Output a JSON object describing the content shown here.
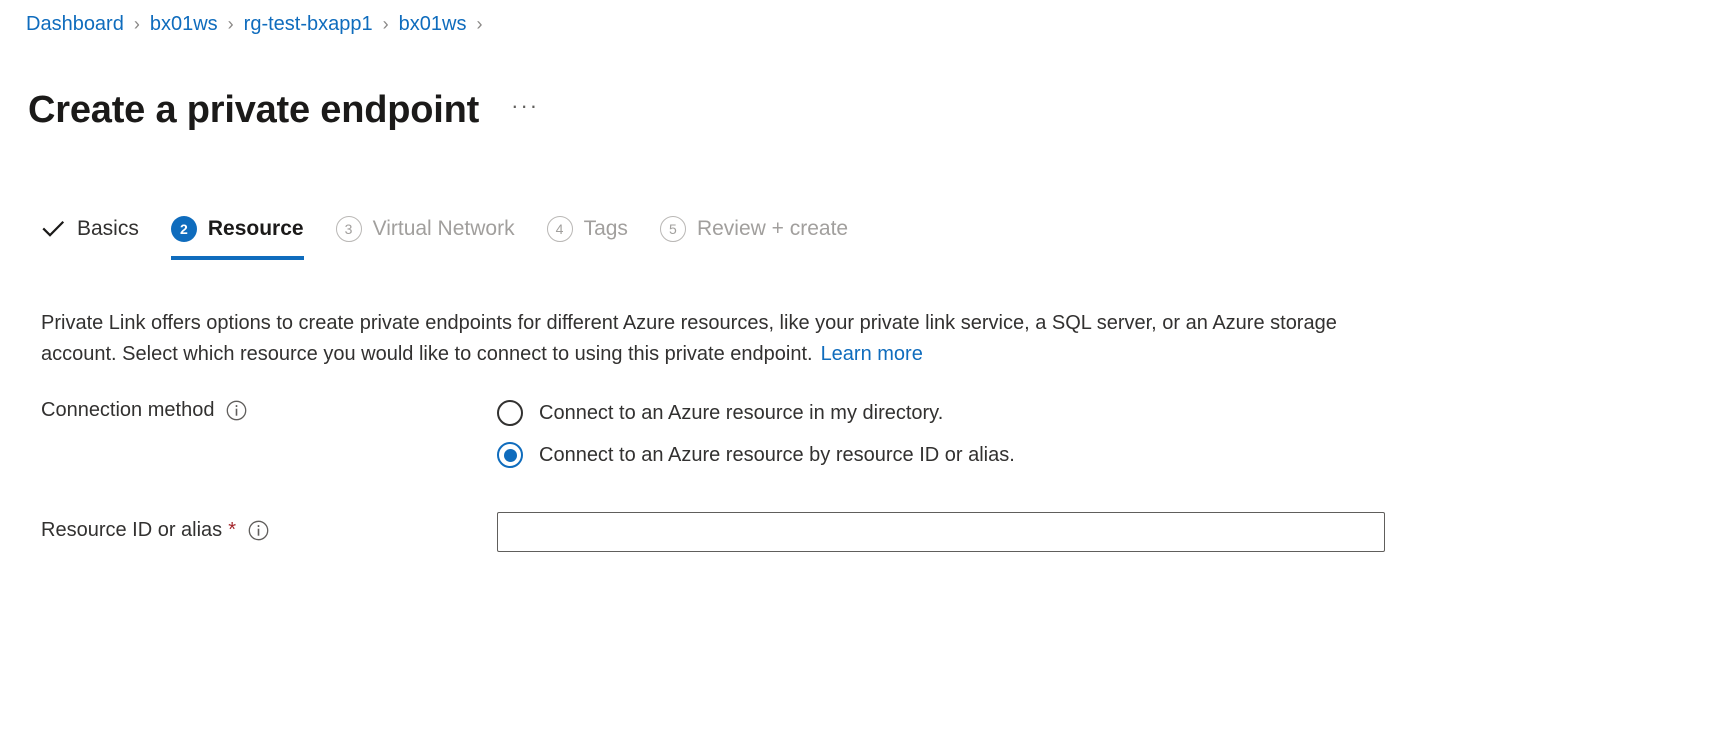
{
  "breadcrumb": {
    "separator": "›",
    "items": [
      {
        "label": "Dashboard"
      },
      {
        "label": "bx01ws"
      },
      {
        "label": "rg-test-bxapp1"
      },
      {
        "label": "bx01ws"
      }
    ],
    "trailing_separator": "›"
  },
  "header": {
    "title": "Create a private endpoint",
    "more_actions": "···"
  },
  "wizard": {
    "tabs": [
      {
        "label": "Basics",
        "badge": "✓",
        "state": "done"
      },
      {
        "label": "Resource",
        "badge": "2",
        "state": "active"
      },
      {
        "label": "Virtual Network",
        "badge": "3",
        "state": "disabled"
      },
      {
        "label": "Tags",
        "badge": "4",
        "state": "disabled"
      },
      {
        "label": "Review + create",
        "badge": "5",
        "state": "disabled"
      }
    ]
  },
  "main": {
    "description": "Private Link offers options to create private endpoints for different Azure resources, like your private link service, a SQL server, or an Azure storage account. Select which resource you would like to connect to using this private endpoint.",
    "learn_more_label": "Learn more",
    "connection_method": {
      "label": "Connection method",
      "info_icon": "info-icon",
      "options": [
        {
          "label": "Connect to an Azure resource in my directory.",
          "selected": false
        },
        {
          "label": "Connect to an Azure resource by resource ID or alias.",
          "selected": true
        }
      ]
    },
    "resource_id": {
      "label": "Resource ID or alias",
      "required_marker": "*",
      "info_icon": "info-icon",
      "value": "",
      "placeholder": ""
    }
  },
  "colors": {
    "accent": "#0f6cbd",
    "link": "#0f6cbd",
    "required": "#a4262c",
    "text": "#323130",
    "disabled_text": "#a19f9d",
    "background": "#ffffff"
  }
}
